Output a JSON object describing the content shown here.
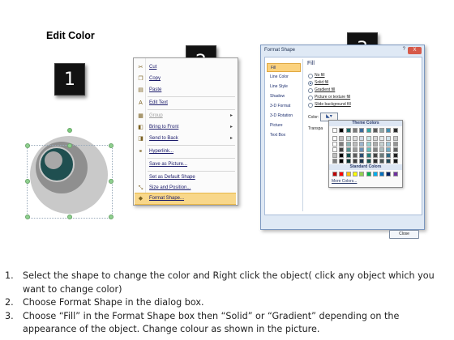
{
  "title": "Edit Color",
  "steps": [
    "1",
    "2",
    "3"
  ],
  "context_menu": {
    "items": [
      {
        "label": "Cut",
        "icon": "cut-icon",
        "glyph": "✂",
        "disabled": false,
        "submenu": false
      },
      {
        "label": "Copy",
        "icon": "copy-icon",
        "glyph": "❐",
        "disabled": false,
        "submenu": false
      },
      {
        "label": "Paste",
        "icon": "paste-icon",
        "glyph": "▤",
        "disabled": false,
        "submenu": false
      },
      {
        "label": "Edit Text",
        "icon": "edit-text-icon",
        "glyph": "A",
        "disabled": false,
        "submenu": false
      },
      {
        "label": "Group",
        "icon": "group-icon",
        "glyph": "▦",
        "disabled": true,
        "submenu": true
      },
      {
        "label": "Bring to Front",
        "icon": "bring-front-icon",
        "glyph": "◧",
        "disabled": false,
        "submenu": true
      },
      {
        "label": "Send to Back",
        "icon": "send-back-icon",
        "glyph": "◨",
        "disabled": false,
        "submenu": true
      },
      {
        "label": "Hyperlink...",
        "icon": "hyperlink-icon",
        "glyph": "⚭",
        "disabled": false,
        "submenu": false
      },
      {
        "label": "Save as Picture...",
        "icon": "",
        "glyph": "",
        "disabled": false,
        "submenu": false
      },
      {
        "label": "Set as Default Shape",
        "icon": "",
        "glyph": "",
        "disabled": false,
        "submenu": false
      },
      {
        "label": "Size and Position...",
        "icon": "size-position-icon",
        "glyph": "⤡",
        "disabled": false,
        "submenu": false
      },
      {
        "label": "Format Shape...",
        "icon": "format-shape-icon",
        "glyph": "◆",
        "disabled": false,
        "submenu": false
      }
    ]
  },
  "dialog": {
    "title": "Format Shape",
    "help": "?",
    "close_x": "X",
    "nav": [
      "Fill",
      "Line Color",
      "Line Style",
      "Shadow",
      "3-D Format",
      "3-D Rotation",
      "Picture",
      "Text Box"
    ],
    "pane_title": "Fill",
    "options": [
      {
        "label": "No fill",
        "selected": false
      },
      {
        "label": "Solid fill",
        "selected": true
      },
      {
        "label": "Gradient fill",
        "selected": false
      },
      {
        "label": "Picture or texture fill",
        "selected": false
      },
      {
        "label": "Slide background fill",
        "selected": false
      }
    ],
    "color_label": "Color:",
    "transparency_label": "Transpa",
    "close_button": "Close",
    "palette": {
      "theme_title": "Theme Colors",
      "standard_title": "Standard Colors",
      "more_colors": "More Colors...",
      "theme_top": [
        "#ffffff",
        "#000000",
        "#1b6b6b",
        "#7a7a7a",
        "#3a6a9a",
        "#2fa6a6",
        "#5a5a5a",
        "#8fa6a6",
        "#3f8fb0",
        "#2a2a2a"
      ],
      "standard": [
        "#c00000",
        "#ff0000",
        "#ffc000",
        "#ffff00",
        "#92d050",
        "#00b050",
        "#00b0f0",
        "#0070c0",
        "#002060",
        "#7030a0"
      ]
    }
  },
  "instructions": [
    {
      "num": "1.",
      "text": "Select the shape to change the color and Right click the object( click any object which you want to change color)"
    },
    {
      "num": "2.",
      "text": "Choose Format Shape in the dialog box."
    },
    {
      "num": "3.",
      "text": "Choose “Fill” in the Format Shape box then “Solid” or “Gradient” depending on the appearance of the object. Change colour as shown in the picture."
    }
  ]
}
